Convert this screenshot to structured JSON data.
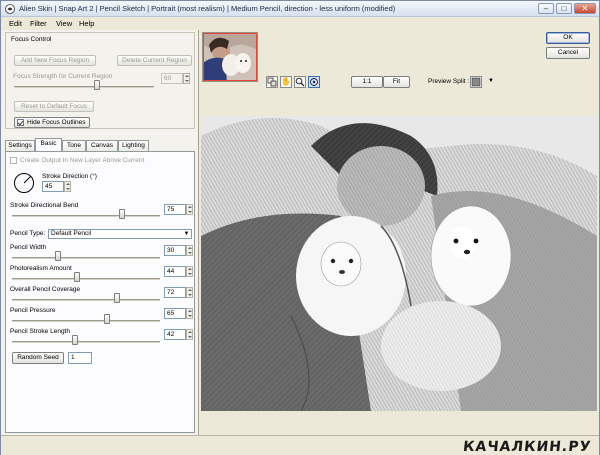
{
  "window": {
    "title": "Alien Skin | Snap Art 2 | Pencil Sketch | Portrait (most realism) | Medium Pencil, direction - less uniform (modified)"
  },
  "menu": [
    "Edit",
    "Filter",
    "View",
    "Help"
  ],
  "focus_control": {
    "legend": "Focus Control",
    "add_region_label": "Add New Focus Region",
    "delete_region_label": "Delete Current Region",
    "strength_label": "Focus Strength for Current Region",
    "strength_value": "60",
    "reset_label": "Reset to Default Focus",
    "hide_outlines_label": "Hide Focus Outlines"
  },
  "tabs": [
    "Settings",
    "Basic",
    "Tone",
    "Canvas",
    "Lighting"
  ],
  "basic": {
    "create_output_label": "Create Output In New Layer Above Current",
    "stroke_direction_label": "Stroke Direction (°)",
    "stroke_direction_value": "45",
    "directional_bend_label": "Stroke Directional Bend",
    "directional_bend_value": "75",
    "pencil_type_label": "Pencil Type:",
    "pencil_type_value": "Default Pencil",
    "pencil_width_label": "Pencil Width",
    "pencil_width_value": "30",
    "photorealism_label": "Photorealism Amount",
    "photorealism_value": "44",
    "coverage_label": "Overall Pencil Coverage",
    "coverage_value": "72",
    "pressure_label": "Pencil Pressure",
    "pressure_value": "65",
    "stroke_length_label": "Pencil Stroke Length",
    "stroke_length_value": "42",
    "random_seed_label": "Random Seed",
    "random_seed_value": "1"
  },
  "sliders": {
    "focus_strength": 0.6,
    "directional_bend": 0.75,
    "pencil_width": 0.3,
    "photorealism": 0.44,
    "coverage": 0.72,
    "pressure": 0.65,
    "stroke_length": 0.42
  },
  "toolbar": {
    "zoom_1to1_label": "1:1",
    "fit_label": "Fit",
    "preview_split_label": "Preview Split :"
  },
  "dialog": {
    "ok_label": "OK",
    "cancel_label": "Cancel"
  },
  "watermark": "КАЧАЛКИН.РУ",
  "icons": [
    "app-icon",
    "minimize-icon",
    "maximize-icon",
    "close-icon",
    "compare-icon",
    "hand-icon",
    "zoom-icon",
    "focus-icon",
    "preview-split-icon",
    "dropdown-arrow-icon"
  ]
}
